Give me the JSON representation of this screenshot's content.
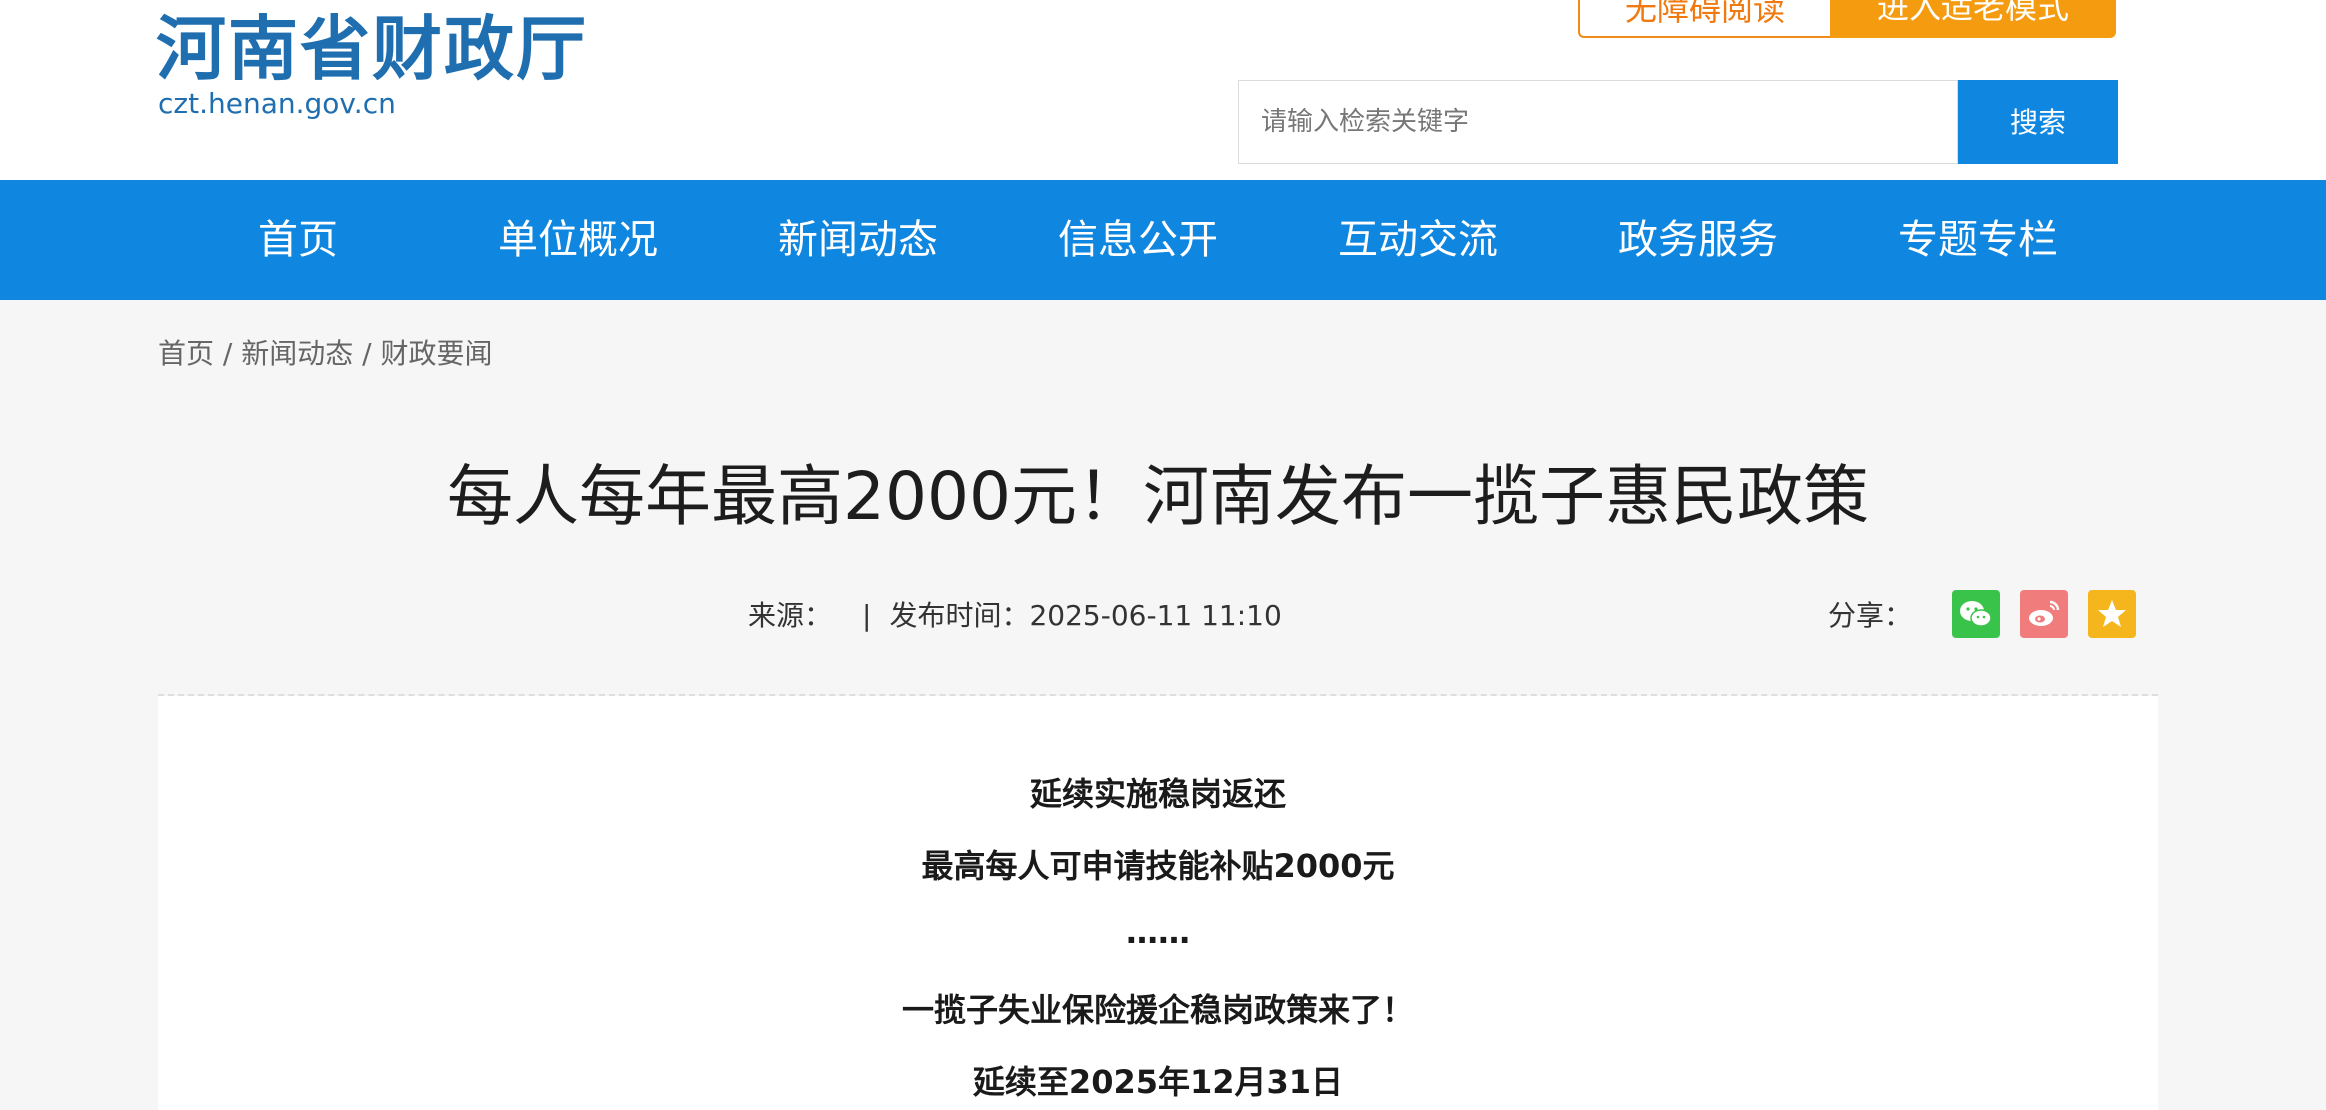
{
  "header": {
    "logo_title": "河南省财政厅",
    "logo_domain": "czt.henan.gov.cn",
    "accessible_label": "无障碍阅读",
    "elderly_label": "进入适老模式",
    "search_placeholder": "请输入检索关键字",
    "search_label": "搜索"
  },
  "nav": {
    "items": [
      "首页",
      "单位概况",
      "新闻动态",
      "信息公开",
      "互动交流",
      "政务服务",
      "专题专栏"
    ]
  },
  "breadcrumb": {
    "items": [
      "首页",
      "新闻动态",
      "财政要闻"
    ],
    "separator": " / "
  },
  "article": {
    "title": "每人每年最高2000元！河南发布一揽子惠民政策",
    "source_label": "来源：",
    "separator": "|",
    "publish_label": "发布时间：",
    "publish_time": "2025-06-11 11:10",
    "share_label": "分享："
  },
  "share_icons": {
    "wechat": "wechat-icon",
    "weibo": "weibo-icon",
    "favorite": "star-icon"
  },
  "content": {
    "paragraphs": [
      "延续实施稳岗返还",
      "最高每人可申请技能补贴2000元",
      "……",
      "一揽子失业保险援企稳岗政策来了！",
      "延续至2025年12月31日"
    ]
  },
  "colors": {
    "brand_blue": "#0f86df",
    "logo_blue": "#1f6eb0",
    "accent_orange": "#f59b0f",
    "wechat_green": "#3ac34a",
    "weibo_red": "#f07c7c",
    "favorite_yellow": "#f5b51d"
  }
}
